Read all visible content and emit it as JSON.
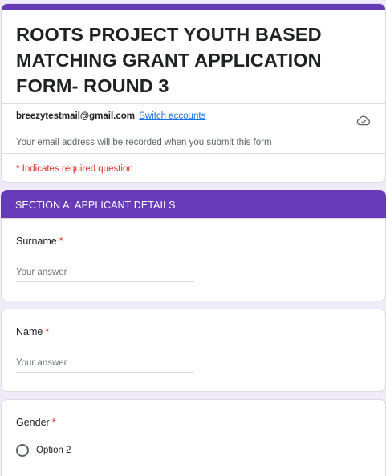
{
  "form": {
    "title": "ROOTS PROJECT YOUTH BASED MATCHING GRANT APPLICATION FORM- ROUND 3",
    "account_email": "breezytestmail@gmail.com",
    "switch_accounts": "Switch accounts",
    "record_notice": "Your email address will be recorded when you submit this form",
    "required_notice": "* Indicates required question"
  },
  "section": {
    "title": "SECTION A: APPLICANT DETAILS"
  },
  "questions": [
    {
      "label": "Surname",
      "required_mark": "*",
      "placeholder": "Your answer"
    },
    {
      "label": "Name",
      "required_mark": "*",
      "placeholder": "Your answer"
    },
    {
      "label": "Gender",
      "required_mark": "*",
      "options": [
        "Option 2"
      ]
    }
  ],
  "icons": {
    "save_status": "cloud-check-icon"
  },
  "colors": {
    "accent": "#673ab7",
    "background": "#f0ebf8",
    "required": "#d93025",
    "link": "#1a73e8"
  }
}
